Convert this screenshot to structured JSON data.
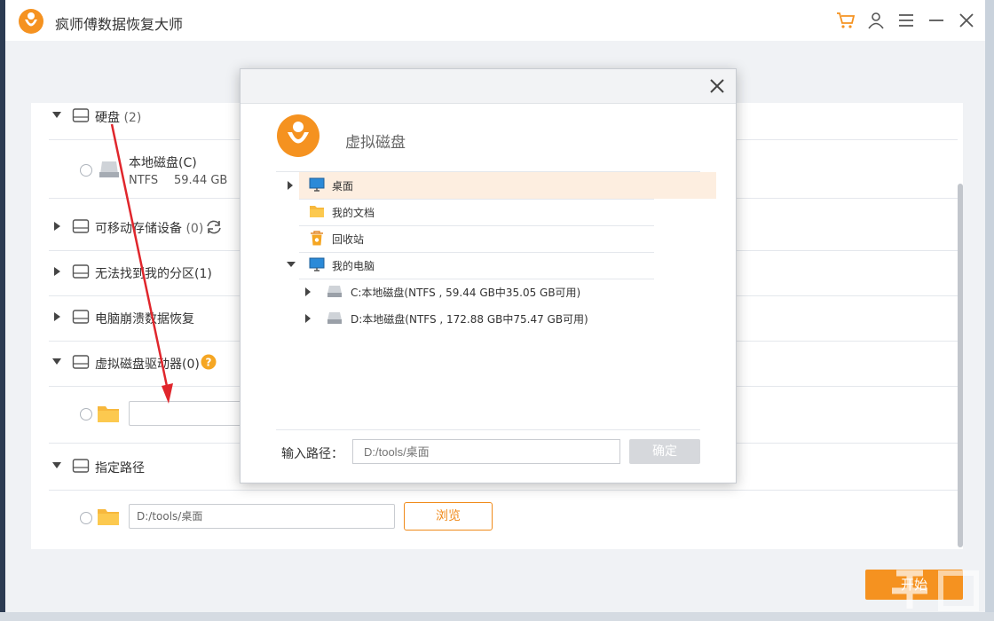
{
  "app": {
    "title": "疯师傅数据恢复大师"
  },
  "titlebar": {
    "icons": [
      "cart-icon",
      "user-icon",
      "menu-icon",
      "minimize-icon",
      "close-icon"
    ]
  },
  "colors": {
    "accent": "#f59220",
    "selected_row": "#fdeee0"
  },
  "sections": {
    "hard_disk": {
      "label": "硬盘",
      "count": "(2)"
    },
    "local_disk": {
      "name": "本地磁盘(C)",
      "fs": "NTFS",
      "size": "59.44 GB"
    },
    "removable": {
      "label": "可移动存储设备",
      "count": "(0)"
    },
    "lost_partition": {
      "label": "无法找到我的分区(1)"
    },
    "crash_recovery": {
      "label": "电脑崩溃数据恢复"
    },
    "virtual_disk": {
      "label": "虚拟磁盘驱动器(0)",
      "input_value": ""
    },
    "specified_path": {
      "label": "指定路径",
      "input_value": "D:/tools/桌面",
      "browse_label": "浏览"
    }
  },
  "start_button": {
    "label": "开始"
  },
  "dialog": {
    "title": "虚拟磁盘",
    "tree": [
      {
        "label": "桌面",
        "selected": true
      },
      {
        "label": "我的文档"
      },
      {
        "label": "回收站"
      },
      {
        "label": "我的电脑"
      },
      {
        "label": "C:本地磁盘(NTFS , 59.44 GB中35.05 GB可用)"
      },
      {
        "label": "D:本地磁盘(NTFS , 172.88 GB中75.47 GB可用)"
      }
    ],
    "path_label": "输入路径：",
    "path_placeholder": "D:/tools/桌面",
    "ok_label": "确定"
  }
}
